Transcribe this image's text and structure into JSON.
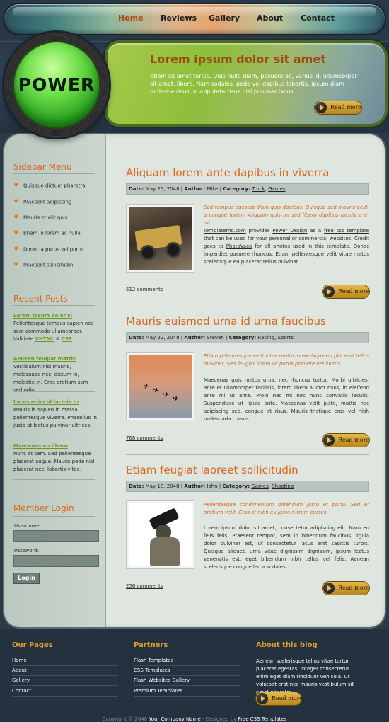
{
  "nav": {
    "items": [
      {
        "label": "Home",
        "active": true
      },
      {
        "label": "Reviews"
      },
      {
        "label": "Gallery"
      },
      {
        "label": "About"
      },
      {
        "label": "Contact"
      }
    ]
  },
  "header": {
    "logo_text": "POWER",
    "banner_title": "Lorem ipsum dolor sit amet",
    "banner_text": "Etiam sit amet turpis. Duis nulla diam, posuere ac, varius id, ullamcorper sit amet, libero. Nam sodales, pede vel dapibus lobortis, ipsum diam molestie risus, a vulputate risus nisl pulvinar lacus.",
    "read_more": "Read more"
  },
  "sidebar": {
    "menu_title": "Sidebar Menu",
    "menu_items": [
      "Quisque dictum pharetra",
      "Praesent adipiscing",
      "Mauris et elit quis",
      "Etiam in lorem ac nulla",
      "Donec a purus vel purus",
      "Praesent sollicitudin"
    ],
    "recent_title": "Recent Posts",
    "recent_posts": [
      {
        "title": "Lorem ipsum dolor si",
        "text": "Pellentesque tempus sapien nec sem commodo ullamcorper. Validate",
        "link1": "XHTML",
        "and": "&",
        "link2": "CSS",
        "end": "."
      },
      {
        "title": "Aenean feugiat mattis",
        "text": "Vestibulum nisl mauris, malesuada nec, dictum in, molestie in. Cras pretium sem sed odio."
      },
      {
        "title": "Lacus enim id lacinia in",
        "text": "Mauris in sapien in massa pellentesque viverra. Phasellus in justo at lectus pulvinar ultrices."
      },
      {
        "title": "Maecenas eu libero",
        "text": "Nunc at sem. Sed pellentesque placerat augue. Mauris pede nisl, placerat nec, lobortis vitae."
      }
    ],
    "login_title": "Member Login",
    "username_label": "Username:",
    "password_label": "Password:",
    "login_button": "Login"
  },
  "posts": [
    {
      "title": "Aliquam lorem ante dapibus in viverra",
      "date_label": "Date:",
      "date": "May 25, 2048",
      "author_label": "Author:",
      "author": "Mike",
      "category_label": "Category:",
      "categories": [
        "Truck",
        "Games"
      ],
      "intro": "Sed tempus egestas diam quis dapibus. Quisque sed mauris velit, a congue lorem. Aliquam quis mi sed libero dapibus iaculis a et mi.",
      "body_link1": "templatemo.com",
      "body_t1": "provides",
      "body_link2": "Power Design",
      "body_t2": "as a",
      "body_link3": "free css template",
      "body_t3": "that can be used for your personal or commercial websites. Credit goes to",
      "body_link4": "PhotoVaco",
      "body_t4": "for all photos used in this template. Donec imperdiet posuere rhoncus. Etiam pellentesque velit vitae metus scelerisque eu placerat tellus pulvinar.",
      "comments": "512 comments",
      "image": "truck-image"
    },
    {
      "title": "Mauris euismod urna id urna faucibus",
      "date_label": "Date:",
      "date": "May 22, 2048",
      "author_label": "Author:",
      "author": "Steven",
      "category_label": "Category:",
      "categories": [
        "Racing",
        "Sports"
      ],
      "intro": "Etiam pellentesque velit vitae metus scelerisque eu placerat tellus pulvinar. Sed feugiat libero ac purus posuere vel luctus.",
      "body": "Maecenas quis metus urna, nec rhoncus tortor. Morbi ultricies, ante et ullamcorper facilisis, lorem libero auctor risus, in eleifend ante mi ut ante. Proin nec mi nec nunc convallis iaculis. Suspendisse ut ligula ante. Maecenas velit justo, mattis nec adipiscing sed, congue at risus. Mauris tristique eros vel nibh malesuada cursus.",
      "comments": "768 comments",
      "image": "jets-image"
    },
    {
      "title": "Etiam feugiat laoreet sollicitudin",
      "date_label": "Date:",
      "date": "May 18, 2048",
      "author_label": "Author:",
      "author": "John",
      "category_label": "Category:",
      "categories": [
        "Games",
        "Shooting"
      ],
      "intro": "Pellentesque condimentum bibendum justo et porta. Sed et pretium velit. Cras at nibh eu justo rutrum cursus.",
      "body": "Lorem ipsum dolor sit amet, consectetur adipiscing elit. Nam eu felis felis. Praesent tempor, sem in bibendum faucibus, ligula dolor pulvinar est, ut consectetur lacus erat sagittis turpis. Quisque aliquet, urna vitae dignissim dignissim, ipsum lectus venenatis est, eget bibendum nibh tellus vel felis. Aenean scelerisque congue leo a sodales.",
      "comments": "256 comments",
      "image": "soldier-image"
    }
  ],
  "footer": {
    "pages_title": "Our Pages",
    "pages": [
      "Home",
      "About",
      "Gallery",
      "Contact"
    ],
    "partners_title": "Partners",
    "partners": [
      "Flash Templates",
      "CSS Templates",
      "Flash Websites Gallery",
      "Premium Templates"
    ],
    "about_title": "About this blog",
    "about_text": "Aenean scelerisque tellus vitae tortor placerat egestas. Integer consectetur enim eget diam tincidunt vehicula. Ut volutpat erat nec mauris vestibulum sit amet pharetra.",
    "copyright_pre": "Copyright © 2048",
    "company": "Your Company Name",
    "designed_by": "- Designed by",
    "designer": "Free CSS Templates"
  },
  "colors": {
    "accent_orange": "#d9661a",
    "accent_green": "#6a9a18",
    "footer_heading": "#e0a028",
    "page_bg": "#2c3a48"
  }
}
